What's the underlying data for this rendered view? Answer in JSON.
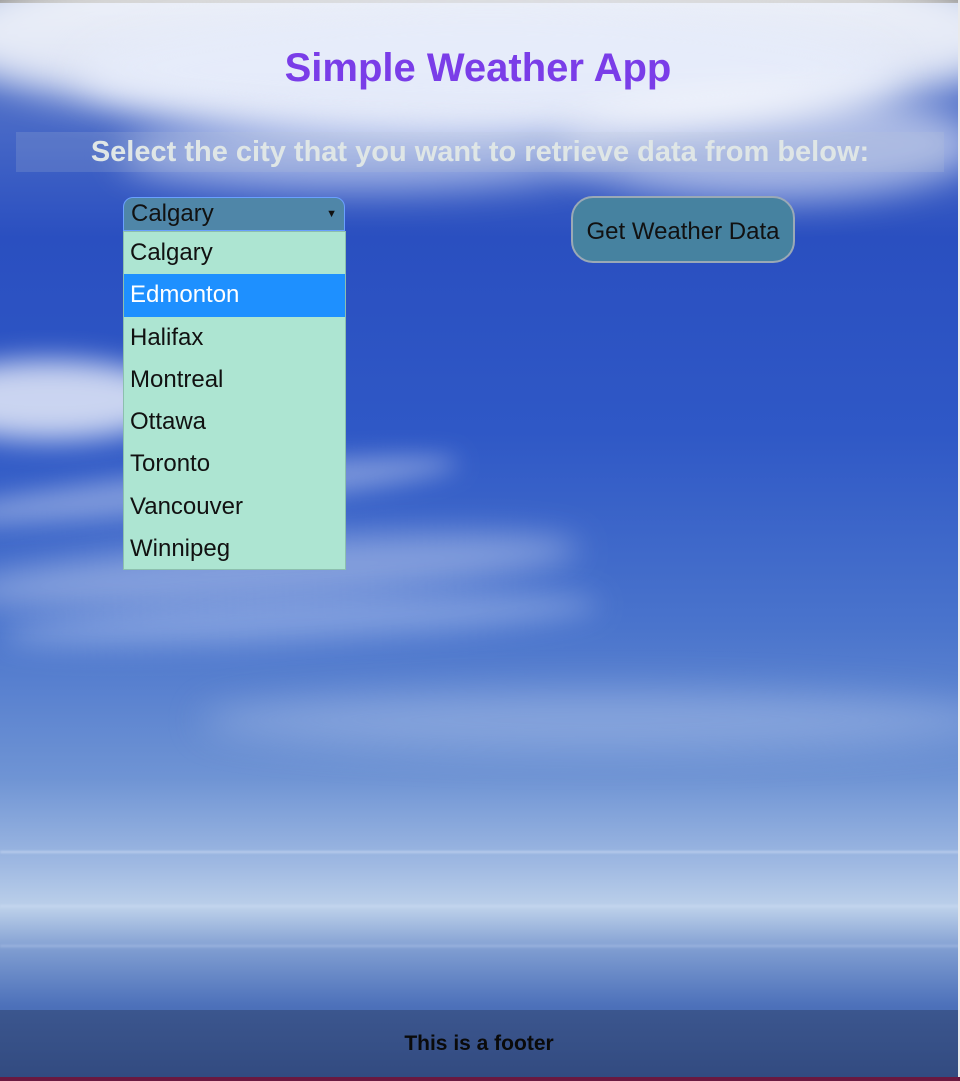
{
  "app": {
    "title": "Simple Weather App",
    "instruction": "Select the city that you want to retrieve data from below:"
  },
  "city_select": {
    "selected_value": "Calgary",
    "arrow_icon": "dropdown-triangle-icon",
    "highlighted_option": "Edmonton",
    "options": [
      "Calgary",
      "Edmonton",
      "Halifax",
      "Montreal",
      "Ottawa",
      "Toronto",
      "Vancouver",
      "Winnipeg"
    ]
  },
  "action": {
    "button_label": "Get Weather Data"
  },
  "footer": {
    "text": "This is a footer"
  },
  "colors": {
    "title": "#7a3de8",
    "instruction": "#dfe6e6",
    "select_bg": "#4f86a8",
    "dropdown_bg": "#ade5d2",
    "option_highlight": "#1e90ff",
    "button_bg": "#4682a0"
  }
}
